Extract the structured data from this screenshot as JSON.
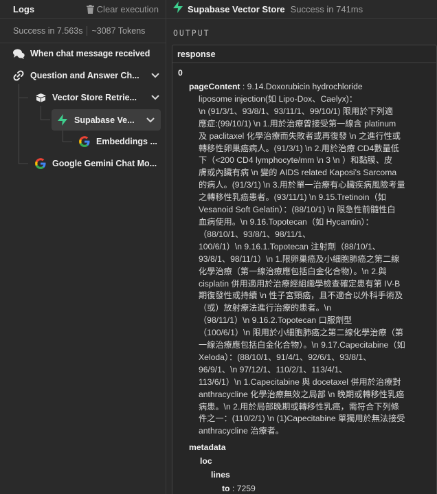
{
  "logs": {
    "title": "Logs",
    "clear_label": "Clear execution",
    "status": "Success in 7.563s",
    "tokens": "~3087 Tokens"
  },
  "tree": [
    {
      "label": "When chat message received",
      "icon": "chat-icon"
    },
    {
      "label": "Question and Answer Ch...",
      "icon": "link-icon"
    },
    {
      "label": "Vector Store Retrie...",
      "icon": "box-icon"
    },
    {
      "label": "Supabase Ve...",
      "icon": "supabase-icon"
    },
    {
      "label": "Embeddings ...",
      "icon": "google-icon"
    },
    {
      "label": "Google Gemini Chat Mo...",
      "icon": "google-icon"
    }
  ],
  "node": {
    "title": "Supabase Vector Store",
    "status": "Success in 741ms"
  },
  "output": {
    "section_label": "OUTPUT",
    "header": "response",
    "index": "0",
    "page_content_key": "pageContent",
    "page_content_lines": [
      "9.14.Doxorubicin hydrochloride",
      "liposome injection(如 Lipo-Dox、Caelyx)：",
      "\\n (91/3/1、93/8/1、93/11/1、99/10/1) 限用於下列適",
      "應症:(99/10/1) \\n 1.用於治療曾接受第一線含 platinum",
      "及 paclitaxel 化學治療而失敗者或再復發 \\n 之進行性或",
      "轉移性卵巢癌病人。(91/3/1) \\n 2.用於治療 CD4數量低",
      "下（<200 CD4 lymphocyte/mm \\n 3 \\n ）和黏膜、皮",
      "膚或內臟有病 \\n 變的 AIDS related Kaposi's Sarcoma",
      "的病人。(91/3/1) \\n 3.用於單一治療有心臟疾病風險考量",
      "之轉移性乳癌患者。(93/11/1) \\n 9.15.Tretinoin（如",
      "Vesanoid Soft Gelatin）：(88/10/1) \\n 限急性前髓性白",
      "血病使用。\\n 9.16.Topotecan（如 Hycamtin）：",
      "（88/10/1、93/8/1、98/11/1、",
      "100/6/1）\\n 9.16.1.Topotecan 注射劑（88/10/1、",
      "93/8/1、98/11/1）\\n 1.限卵巢癌及小細胞肺癌之第二線",
      "化學治療（第一線治療應包括白金化合物）。\\n 2.與",
      "cisplatin 併用適用於治療經組織學檢查確定患有第 IV-B",
      "期復發性或持續 \\n 性子宮頸癌，且不適合以外科手術及",
      "（或）放射療法進行治療的患者。\\n",
      "（98/11/1）\\n 9.16.2.Topotecan 口服劑型",
      "（100/6/1）\\n 限用於小細胞肺癌之第二線化學治療（第",
      "一線治療應包括白金化合物）。\\n 9.17.Capecitabine（如",
      "Xeloda）：(88/10/1、91/4/1、92/6/1、93/8/1、",
      "96/9/1、\\n 97/12/1、110/2/1、113/4/1、",
      "113/6/1）\\n 1.Capecitabine 與 docetaxel 併用於治療對",
      "anthracycline 化學治療無效之局部 \\n 晚期或轉移性乳癌",
      "病患。\\n 2.用於局部晚期或轉移性乳癌，需符合下列條",
      "件之一：(110/2/1) \\n (1)Capecitabine 單獨用於無法接受",
      "anthracycline 治療者。"
    ],
    "metadata_key": "metadata",
    "loc_key": "loc",
    "lines_key": "lines",
    "to_key": "to",
    "to_value": "7259"
  }
}
